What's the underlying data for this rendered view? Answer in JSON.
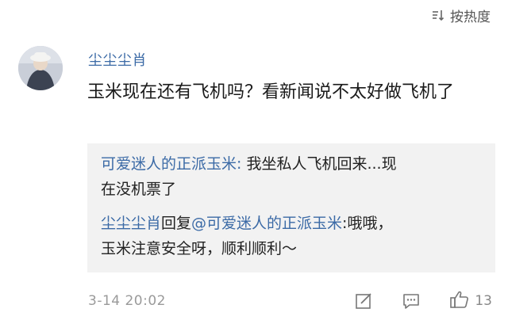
{
  "sort": {
    "label": "按热度",
    "icon": "sort-icon"
  },
  "comment": {
    "username": "尘尘尘肖",
    "text": "玉米现在还有飞机吗？看新闻说不太好做飞机了",
    "timestamp": "3-14 20:02",
    "like_count": "13"
  },
  "replies": [
    {
      "author": "可爱迷人的正派玉米",
      "separator": ": ",
      "text_line1": "我坐私人飞机回来...现",
      "text_line2": "在没机票了"
    },
    {
      "author": "尘尘尘肖",
      "reply_word": "回复",
      "mention": "@可爱迷人的正派玉米",
      "text_line1": ":哦哦，",
      "text_line2": "玉米注意安全呀，顺利顺利～"
    }
  ],
  "icons": [
    "sort-icon",
    "avatar",
    "edit-icon",
    "comment-icon",
    "like-icon"
  ],
  "colors": {
    "link": "#3b6aa6",
    "reply_bg": "#f2f2f2",
    "muted": "#9a9a9a"
  }
}
